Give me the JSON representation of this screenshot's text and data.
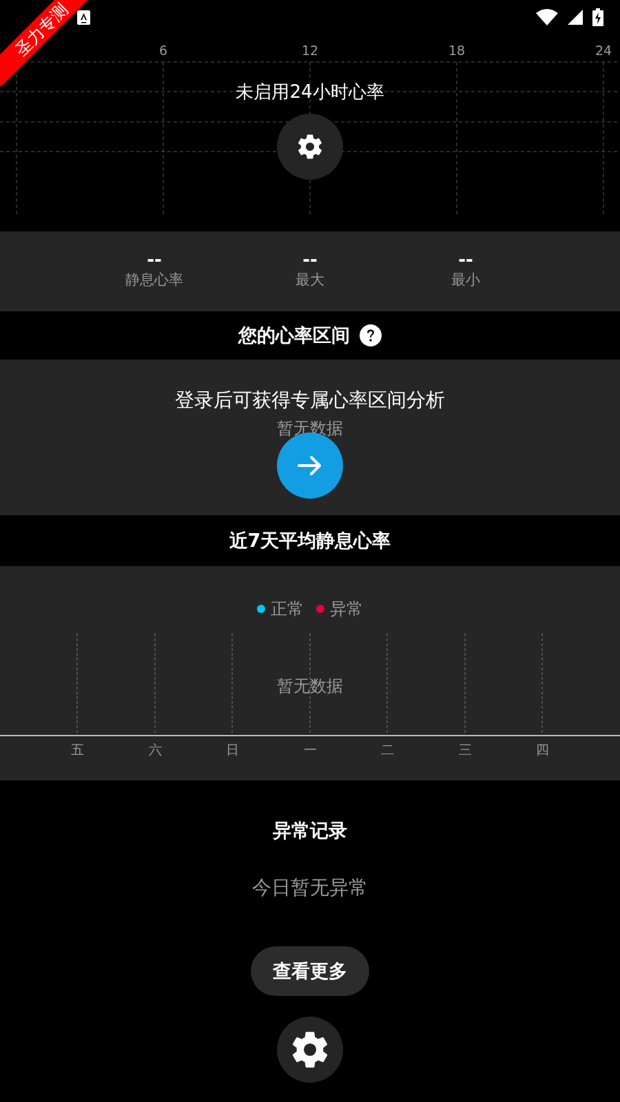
{
  "ribbon": "圣力专测",
  "day_chart": {
    "ticks": [
      "6",
      "12",
      "18",
      "24"
    ],
    "message": "未启用24小时心率"
  },
  "stats": [
    {
      "value": "--",
      "label": "静息心率"
    },
    {
      "value": "--",
      "label": "最大"
    },
    {
      "value": "--",
      "label": "最小"
    }
  ],
  "zone_section": {
    "title": "您的心率区间",
    "login_text": "登录后可获得专属心率区间分析",
    "empty_text": "暂无数据"
  },
  "week_section": {
    "title": "近7天平均静息心率",
    "legend": [
      {
        "label": "正常",
        "color": "#00c8f0"
      },
      {
        "label": "异常",
        "color": "#e8003c"
      }
    ],
    "empty_text": "暂无数据",
    "days": [
      "五",
      "六",
      "日",
      "一",
      "二",
      "三",
      "四"
    ]
  },
  "abnormal_section": {
    "title": "异常记录",
    "empty_text": "今日暂无异常",
    "more_button": "查看更多"
  }
}
